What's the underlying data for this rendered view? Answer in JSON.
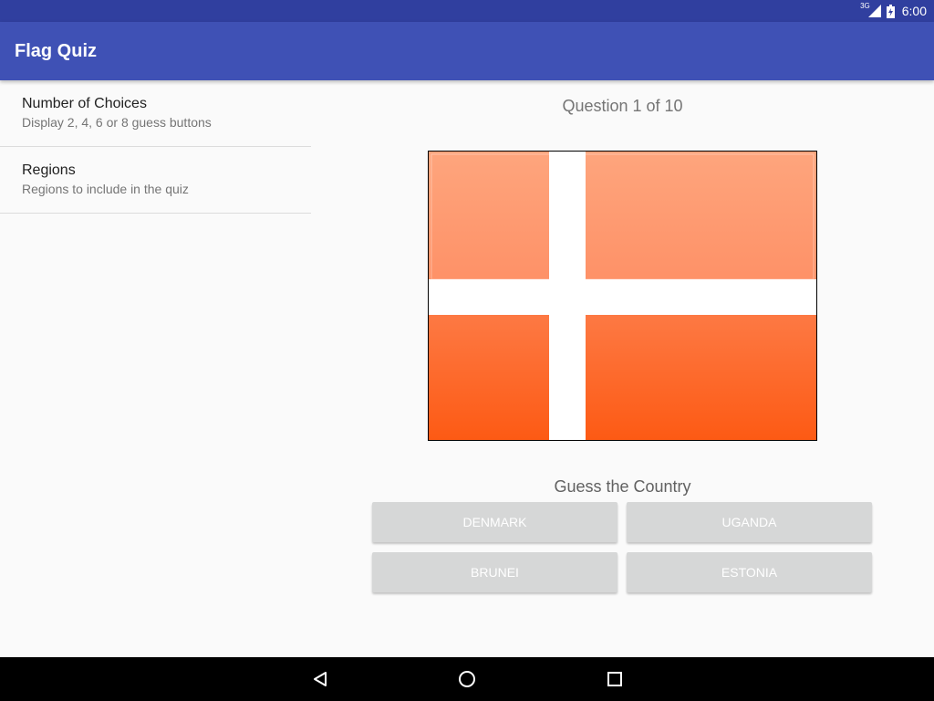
{
  "status_bar": {
    "network_type": "3G",
    "time": "6:00"
  },
  "app_bar": {
    "title": "Flag Quiz",
    "color": "#3f51b5"
  },
  "settings": {
    "items": [
      {
        "title": "Number of Choices",
        "summary": "Display 2, 4, 6 or 8 guess buttons"
      },
      {
        "title": "Regions",
        "summary": "Regions to include in the quiz"
      }
    ]
  },
  "quiz": {
    "question_number": "Question 1 of 10",
    "flag_icon": "denmark-flag",
    "guess_prompt": "Guess the Country",
    "answers": [
      "DENMARK",
      "UGANDA",
      "BRUNEI",
      "ESTONIA"
    ],
    "answer_button_color": "#d6d7d7"
  },
  "nav_bar": {
    "buttons": [
      "back-icon",
      "home-icon",
      "recents-icon"
    ]
  }
}
